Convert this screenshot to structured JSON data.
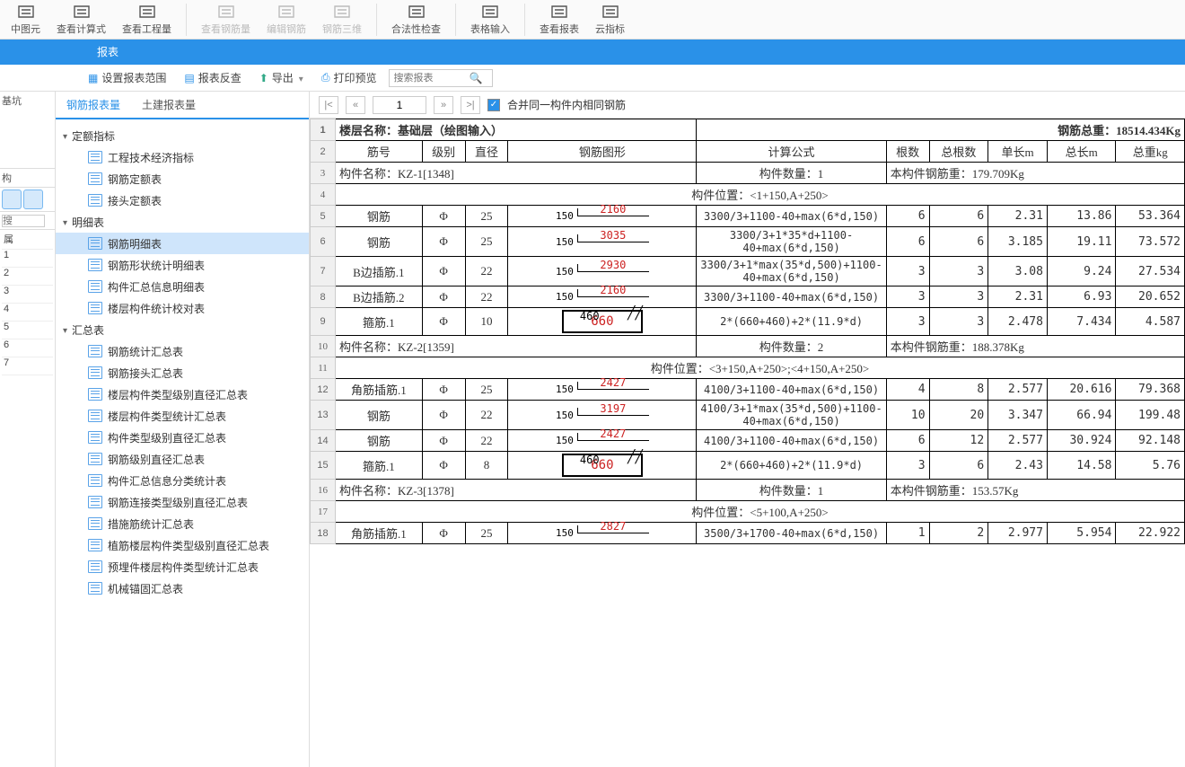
{
  "ribbon": [
    {
      "label": "中图元",
      "disabled": false
    },
    {
      "label": "查看计算式",
      "disabled": false
    },
    {
      "label": "查看工程量",
      "disabled": false
    },
    {
      "label": "查看钢筋量",
      "disabled": true
    },
    {
      "label": "编辑钢筋",
      "disabled": true
    },
    {
      "label": "钢筋三维",
      "disabled": true
    },
    {
      "label": "合法性检查",
      "disabled": false
    },
    {
      "label": "表格输入",
      "disabled": false
    },
    {
      "label": "查看报表",
      "disabled": false
    },
    {
      "label": "云指标",
      "disabled": false
    }
  ],
  "left_strip": {
    "label1": "基坑",
    "label2": "构",
    "search_placeholder": "搜",
    "row_label": "属",
    "rows": [
      1,
      2,
      3,
      4,
      5,
      6,
      7
    ]
  },
  "tabbar": {
    "tab": "报表"
  },
  "subtoolbar": {
    "set_range": "设置报表范围",
    "recheck": "报表反查",
    "export": "导出",
    "print": "打印预览",
    "search_placeholder": "搜索报表"
  },
  "tree_tabs": {
    "rebar": "钢筋报表量",
    "civil": "土建报表量"
  },
  "tree": {
    "g1": {
      "label": "定额指标",
      "items": [
        "工程技术经济指标",
        "钢筋定额表",
        "接头定额表"
      ]
    },
    "g2": {
      "label": "明细表",
      "items": [
        "钢筋明细表",
        "钢筋形状统计明细表",
        "构件汇总信息明细表",
        "楼层构件统计校对表"
      ],
      "selected": 0
    },
    "g3": {
      "label": "汇总表",
      "items": [
        "钢筋统计汇总表",
        "钢筋接头汇总表",
        "楼层构件类型级别直径汇总表",
        "楼层构件类型统计汇总表",
        "构件类型级别直径汇总表",
        "钢筋级别直径汇总表",
        "构件汇总信息分类统计表",
        "钢筋连接类型级别直径汇总表",
        "措施筋统计汇总表",
        "植筋楼层构件类型级别直径汇总表",
        "预埋件楼层构件类型统计汇总表",
        "机械锚固汇总表"
      ]
    }
  },
  "pager": {
    "page": "1",
    "merge_label": "合并同一构件内相同钢筋"
  },
  "report": {
    "title_left": "楼层名称：基础层（绘图输入）",
    "title_right_label": "钢筋总重：",
    "title_right_value": "18514.434Kg",
    "headers": [
      "筋号",
      "级别",
      "直径",
      "钢筋图形",
      "计算公式",
      "根数",
      "总根数",
      "单长m",
      "总长m",
      "总重kg"
    ],
    "sections": [
      {
        "name": "构件名称：KZ-1[1348]",
        "qty": "构件数量：1",
        "wt_label": "本构件钢筋重：",
        "wt": "179.709Kg",
        "pos": "构件位置：<1+150,A+250>",
        "rows": [
          {
            "n": 5,
            "name": "钢筋",
            "g": "Φ",
            "d": "25",
            "s": {
              "t": "l",
              "end": "150",
              "dim": "2160"
            },
            "f": "3300/3+1100-40+max(6*d,150)",
            "q": "6",
            "tq": "6",
            "ul": "2.31",
            "tl": "13.86",
            "w": "53.364"
          },
          {
            "n": 6,
            "name": "钢筋",
            "g": "Φ",
            "d": "25",
            "s": {
              "t": "l",
              "end": "150",
              "dim": "3035"
            },
            "f": "3300/3+1*35*d+1100-40+max(6*d,150)",
            "q": "6",
            "tq": "6",
            "ul": "3.185",
            "tl": "19.11",
            "w": "73.572"
          },
          {
            "n": 7,
            "name": "B边插筋.1",
            "g": "Φ",
            "d": "22",
            "s": {
              "t": "l",
              "end": "150",
              "dim": "2930"
            },
            "f": "3300/3+1*max(35*d,500)+1100-40+max(6*d,150)",
            "q": "3",
            "tq": "3",
            "ul": "3.08",
            "tl": "9.24",
            "w": "27.534"
          },
          {
            "n": 8,
            "name": "B边插筋.2",
            "g": "Φ",
            "d": "22",
            "s": {
              "t": "l",
              "end": "150",
              "dim": "2160"
            },
            "f": "3300/3+1100-40+max(6*d,150)",
            "q": "3",
            "tq": "3",
            "ul": "2.31",
            "tl": "6.93",
            "w": "20.652"
          },
          {
            "n": 9,
            "name": "箍筋.1",
            "g": "Φ",
            "d": "10",
            "s": {
              "t": "r",
              "a": "460",
              "b": "660"
            },
            "f": "2*(660+460)+2*(11.9*d)",
            "q": "3",
            "tq": "3",
            "ul": "2.478",
            "tl": "7.434",
            "w": "4.587"
          }
        ]
      },
      {
        "name": "构件名称：KZ-2[1359]",
        "qty": "构件数量：2",
        "wt_label": "本构件钢筋重：",
        "wt": "188.378Kg",
        "pos": "构件位置：<3+150,A+250>;<4+150,A+250>",
        "rows": [
          {
            "n": 12,
            "name": "角筋插筋.1",
            "g": "Φ",
            "d": "25",
            "s": {
              "t": "l",
              "end": "150",
              "dim": "2427"
            },
            "f": "4100/3+1100-40+max(6*d,150)",
            "q": "4",
            "tq": "8",
            "ul": "2.577",
            "tl": "20.616",
            "w": "79.368"
          },
          {
            "n": 13,
            "name": "钢筋",
            "g": "Φ",
            "d": "22",
            "s": {
              "t": "l",
              "end": "150",
              "dim": "3197"
            },
            "f": "4100/3+1*max(35*d,500)+1100-40+max(6*d,150)",
            "q": "10",
            "tq": "20",
            "ul": "3.347",
            "tl": "66.94",
            "w": "199.48"
          },
          {
            "n": 14,
            "name": "钢筋",
            "g": "Φ",
            "d": "22",
            "s": {
              "t": "l",
              "end": "150",
              "dim": "2427"
            },
            "f": "4100/3+1100-40+max(6*d,150)",
            "q": "6",
            "tq": "12",
            "ul": "2.577",
            "tl": "30.924",
            "w": "92.148"
          },
          {
            "n": 15,
            "name": "箍筋.1",
            "g": "Φ",
            "d": "8",
            "s": {
              "t": "r",
              "a": "460",
              "b": "660"
            },
            "f": "2*(660+460)+2*(11.9*d)",
            "q": "3",
            "tq": "6",
            "ul": "2.43",
            "tl": "14.58",
            "w": "5.76"
          }
        ]
      },
      {
        "name": "构件名称：KZ-3[1378]",
        "qty": "构件数量：1",
        "wt_label": "本构件钢筋重：",
        "wt": "153.57Kg",
        "pos": "构件位置：<5+100,A+250>",
        "rows": [
          {
            "n": 18,
            "name": "角筋插筋.1",
            "g": "Φ",
            "d": "25",
            "s": {
              "t": "l",
              "end": "150",
              "dim": "2827"
            },
            "f": "3500/3+1700-40+max(6*d,150)",
            "q": "1",
            "tq": "2",
            "ul": "2.977",
            "tl": "5.954",
            "w": "22.922"
          }
        ]
      }
    ]
  }
}
